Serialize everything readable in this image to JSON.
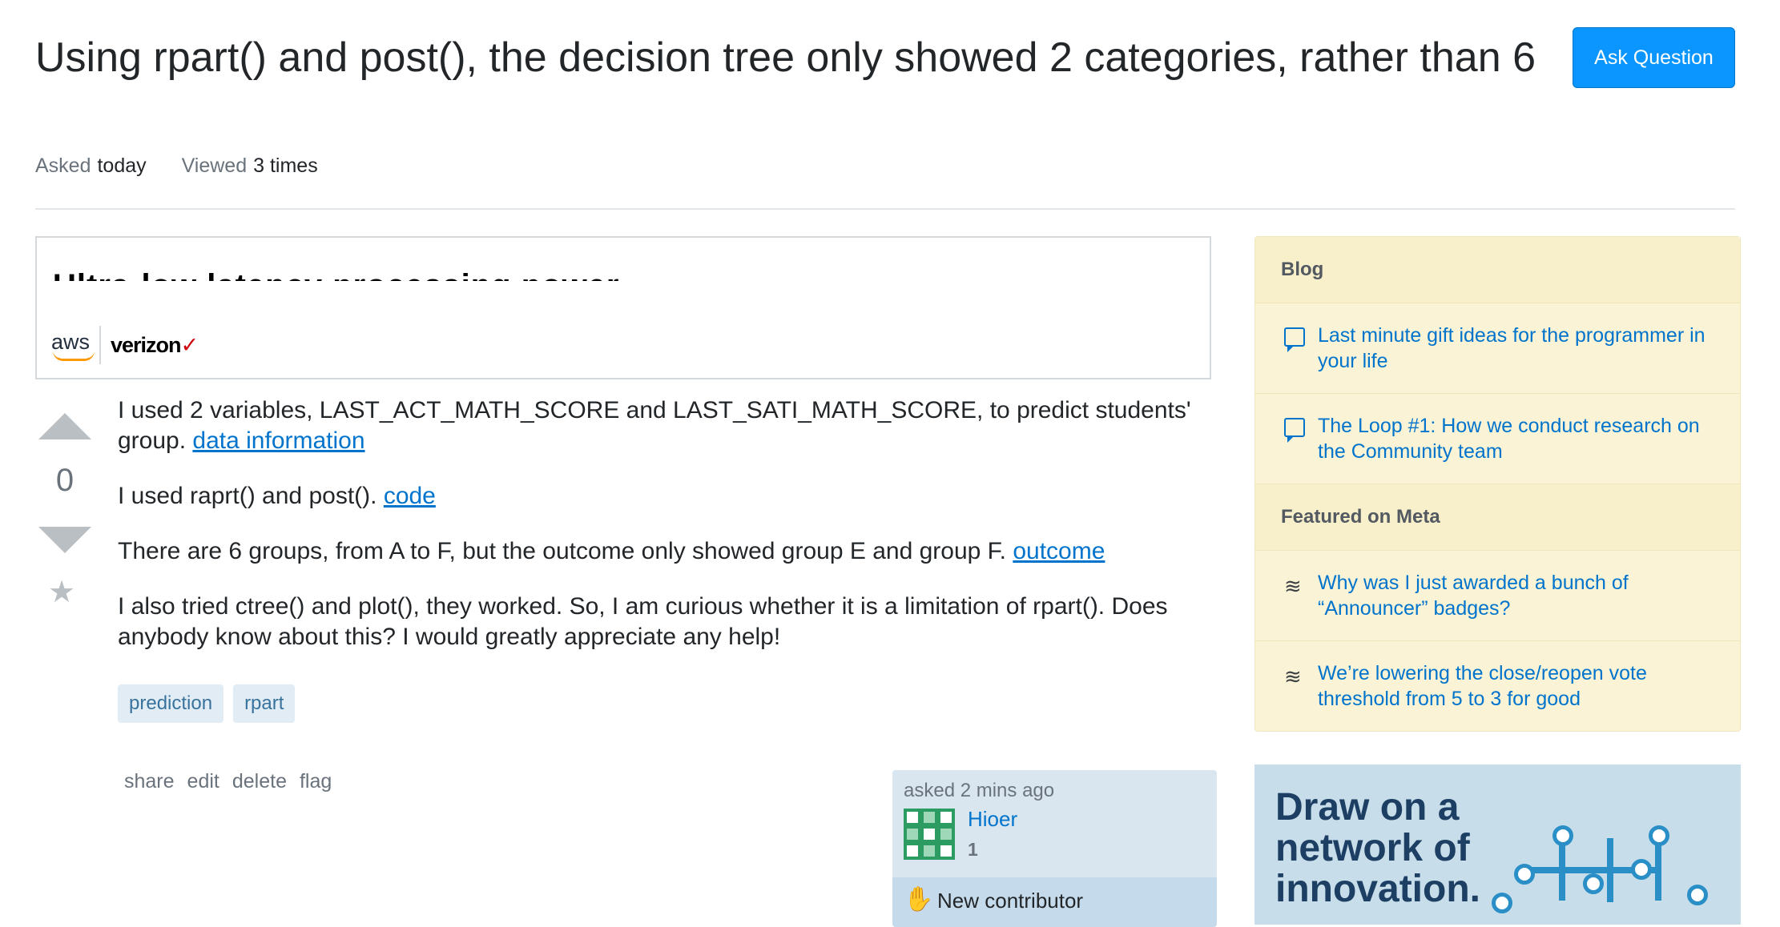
{
  "question": {
    "title": "Using rpart() and post(), the decision tree only showed 2 categories, rather than 6",
    "asked_label": "Asked",
    "asked_value": "today",
    "viewed_label": "Viewed",
    "viewed_value": "3 times"
  },
  "header": {
    "ask_button": "Ask Question"
  },
  "ad": {
    "headline": "Ultra-low latency processing power",
    "logo_aws": "aws",
    "logo_verizon": "verizon",
    "logo_verizon_check": "✓"
  },
  "vote": {
    "count": "0",
    "bookmark_icon": "★"
  },
  "post": {
    "p1_text": "I used 2 variables, LAST_ACT_MATH_SCORE and LAST_SATI_MATH_SCORE, to predict students' group. ",
    "p1_link": "data information",
    "p2_text": "I used raprt() and post(). ",
    "p2_link": "code",
    "p3_text": "There are 6 groups, from A to F, but the outcome only showed group E and group F. ",
    "p3_link": "outcome",
    "p4_text": "I also tried ctree() and plot(), they worked. So, I am curious whether it is a limitation of rpart(). Does anybody know about this? I would greatly appreciate any help!"
  },
  "tags": [
    "prediction",
    "rpart"
  ],
  "post_menu": {
    "share": "share",
    "edit": "edit",
    "delete": "delete",
    "flag": "flag"
  },
  "user_card": {
    "asked": "asked 2 mins ago",
    "name": "Hioer",
    "reputation": "1",
    "new_contributor": "New contributor",
    "new_contributor_icon": "wave-hand-icon"
  },
  "sidebar": {
    "blog_header": "Blog",
    "blog_items": [
      "Last minute gift ideas for the programmer in your life",
      "The Loop #1: How we conduct research on the Community team"
    ],
    "meta_header": "Featured on Meta",
    "meta_items": [
      "Why was I just awarded a bunch of “Announcer” badges?",
      "We’re lowering the close/reopen vote threshold from 5 to 3 for good"
    ]
  },
  "banner": {
    "line1": "Draw on a",
    "line2": "network of",
    "line3": "innovation."
  },
  "colors": {
    "accent": "#0a95ff",
    "link": "#0074cc",
    "tag_bg": "#e1ecf4",
    "sidebar_bg": "#fbf3d5"
  }
}
